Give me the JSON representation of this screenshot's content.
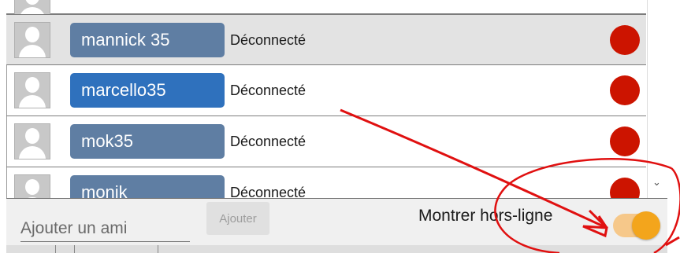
{
  "contacts": [
    {
      "name": "mannick 35",
      "status": "Déconnecté",
      "selected": true,
      "active": false
    },
    {
      "name": "marcello35",
      "status": "Déconnecté",
      "selected": false,
      "active": true
    },
    {
      "name": "mok35",
      "status": "Déconnecté",
      "selected": false,
      "active": false
    },
    {
      "name": "monik",
      "status": "Déconnecté",
      "selected": false,
      "active": false
    }
  ],
  "footer": {
    "add_friend_placeholder": "Ajouter un ami",
    "add_button_label": "Ajouter",
    "show_offline_label": "Montrer hors-ligne",
    "show_offline_enabled": true
  },
  "colors": {
    "name_pill": "#5f7ea3",
    "name_pill_active": "#2f71bd",
    "offline_dot": "#cc1400",
    "toggle_on": "#f3a51c",
    "annotation": "#e01010"
  },
  "icons": [
    "user-avatar-icon",
    "status-dot-icon",
    "chevron-down-icon"
  ]
}
